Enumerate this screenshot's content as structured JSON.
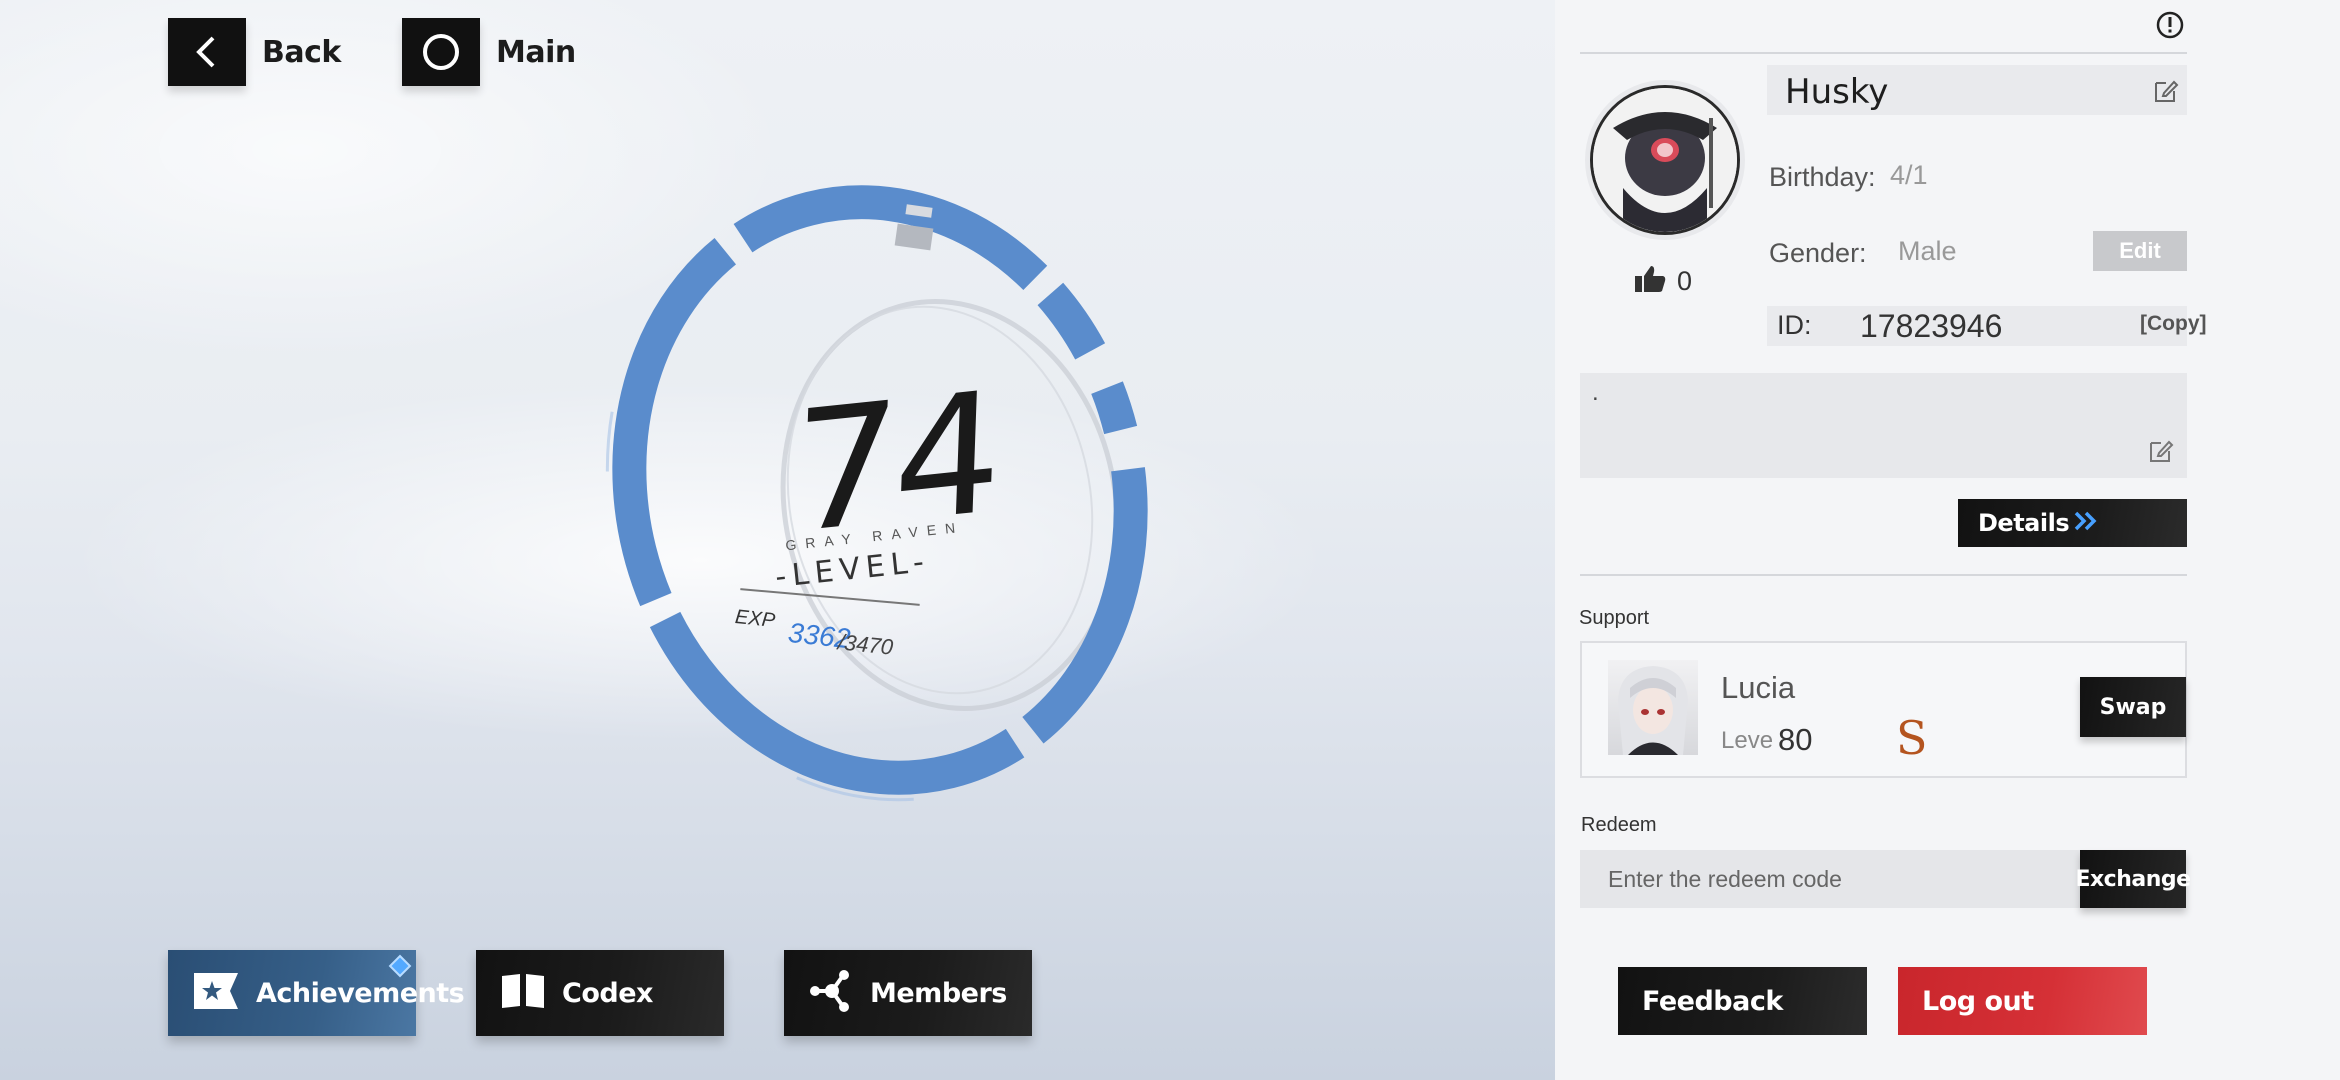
{
  "nav": {
    "back_label": "Back",
    "main_label": "Main"
  },
  "level": {
    "value": "74",
    "team_label": "GRAY  RAVEN",
    "word": "-LEVEL-",
    "exp_label": "EXP",
    "exp_current": "3362",
    "exp_max": "/3470",
    "exp_progress": 0.969
  },
  "bottom_nav": {
    "achievements": "Achievements",
    "codex": "Codex",
    "members": "Members"
  },
  "profile": {
    "name": "Husky",
    "birthday_label": "Birthday:",
    "birthday_value": "4/1",
    "gender_label": "Gender:",
    "gender_value": "Male",
    "edit_label": "Edit",
    "id_label": "ID:",
    "id_value": "17823946",
    "copy_label": "[Copy]",
    "likes": "0",
    "bio": "."
  },
  "details_label": "Details",
  "support": {
    "section_label": "Support",
    "name": "Lucia",
    "level_label": "Leve",
    "level_value": "80",
    "rank": "S",
    "swap_label": "Swap"
  },
  "redeem": {
    "section_label": "Redeem",
    "placeholder": "Enter the redeem code",
    "exchange_label": "Exchange"
  },
  "footer": {
    "feedback_label": "Feedback",
    "logout_label": "Log out"
  },
  "colors": {
    "ring_blue": "#5a8ccc",
    "logout_red": "#d2292f",
    "achievements_blue": "#33597f",
    "exp_blue": "#3a7bd5"
  },
  "icons": {
    "back": "chevron-left-icon",
    "main": "circle-icon",
    "achievements": "star-flag-icon",
    "codex": "book-icon",
    "members": "network-icon",
    "info": "exclamation-circle-icon",
    "edit": "pencil-square-icon",
    "like": "thumbs-up-icon",
    "details": "double-chevron-right-icon"
  }
}
